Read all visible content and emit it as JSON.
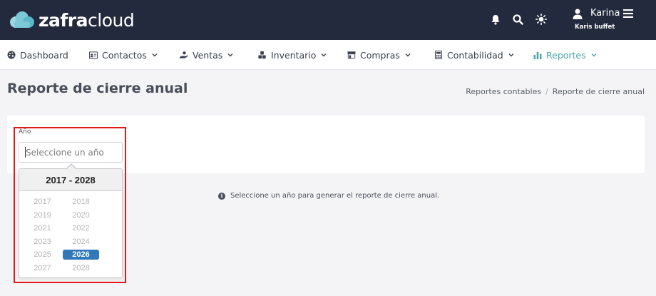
{
  "header": {
    "logo": {
      "bold": "zafra",
      "light": "cloud"
    },
    "icons": [
      "bell-icon",
      "search-icon",
      "sun-icon",
      "user-icon",
      "menu-icon"
    ],
    "user": {
      "name": "Karina",
      "company": "Karis buffet"
    }
  },
  "nav": {
    "items": [
      {
        "label": "Dashboard",
        "icon": "palette-icon",
        "dropdown": false
      },
      {
        "label": "Contactos",
        "icon": "address-card-icon",
        "dropdown": true
      },
      {
        "label": "Ventas",
        "icon": "hand-coin-icon",
        "dropdown": true
      },
      {
        "label": "Inventario",
        "icon": "boxes-icon",
        "dropdown": true
      },
      {
        "label": "Compras",
        "icon": "store-icon",
        "dropdown": true
      },
      {
        "label": "Contabilidad",
        "icon": "calculator-icon",
        "dropdown": true
      },
      {
        "label": "Reportes",
        "icon": "bar-chart-icon",
        "dropdown": true,
        "active": true
      }
    ]
  },
  "page": {
    "title": "Reporte de cierre anual",
    "breadcrumb": [
      "Reportes contables",
      "Reporte de cierre anual"
    ]
  },
  "form": {
    "year_label": "Año",
    "year_value": "",
    "year_placeholder": "Seleccione un año"
  },
  "picker": {
    "range_label": "2017 - 2028",
    "years": [
      "2017",
      "2018",
      "2019",
      "2020",
      "2021",
      "2022",
      "2023",
      "2024",
      "2025",
      "2026",
      "2027",
      "2028"
    ],
    "selected": "2026"
  },
  "info": {
    "message": "Seleccione un año para generar el reporte de cierre anual."
  },
  "colors": {
    "header_bg": "#232a3d",
    "accent": "#4aa3a3",
    "selected_year": "#2f78b9",
    "highlight": "#e0191b"
  }
}
